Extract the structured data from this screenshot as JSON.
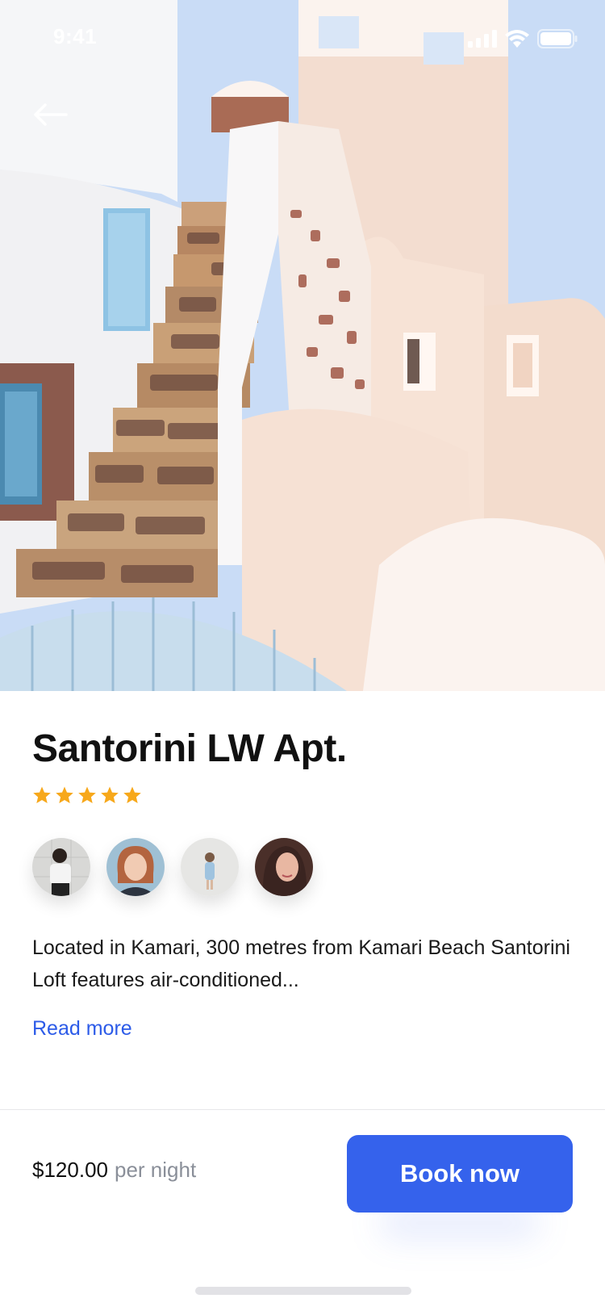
{
  "status_bar": {
    "time": "9:41",
    "icons": [
      "cellular-signal-icon",
      "wifi-icon",
      "battery-icon"
    ]
  },
  "navigation": {
    "back_icon": "arrow-left-icon"
  },
  "listing": {
    "title": "Santorini LW Apt.",
    "rating": 5,
    "rating_max": 5,
    "star_color": "#F7A81B",
    "avatar_count": 4,
    "description": "Located in Kamari, 300 metres from Kamari Beach Santorini Loft features air-conditioned...",
    "read_more_label": "Read more"
  },
  "booking": {
    "price": "$120.00",
    "price_unit": "per night",
    "book_label": "Book now",
    "accent_color": "#3562EC"
  }
}
